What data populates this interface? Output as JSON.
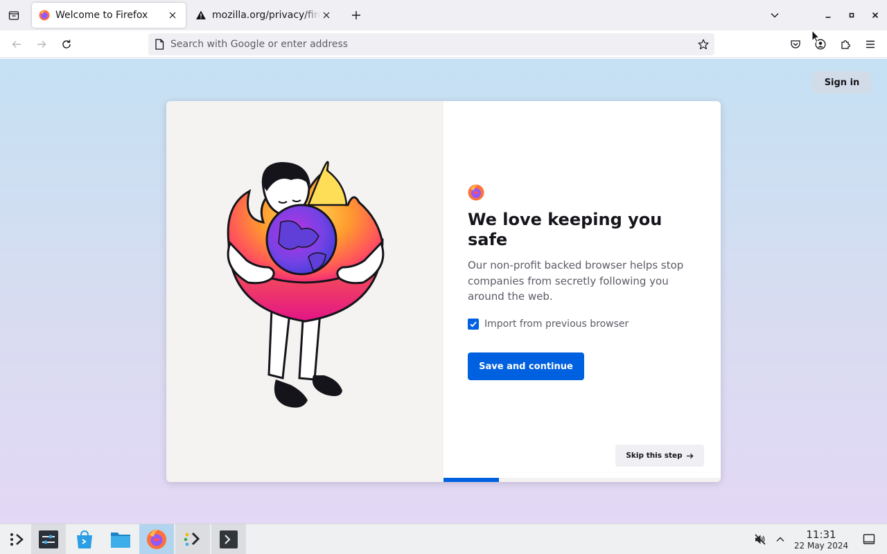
{
  "tabs": [
    {
      "title": "Welcome to Firefox",
      "active": true
    },
    {
      "title": "mozilla.org/privacy/firefox/",
      "active": false
    }
  ],
  "urlbar": {
    "placeholder": "Search with Google or enter address",
    "value": ""
  },
  "toolbar_icons": [
    "pocket-icon",
    "account-icon",
    "extensions-icon",
    "menu-icon"
  ],
  "page": {
    "signin_label": "Sign in",
    "headline": "We love keeping you safe",
    "subtext": "Our non-profit backed browser helps stop companies from secretly following you around the web.",
    "import_label": "Import from previous browser",
    "import_checked": true,
    "primary_label": "Save and continue",
    "skip_label": "Skip this step",
    "progress_fraction": 0.2
  },
  "taskbar": {
    "apps": [
      "app-launcher-icon",
      "system-settings-icon",
      "discover-icon",
      "file-manager-icon",
      "firefox-icon",
      "kdenlive-icon",
      "terminal-icon"
    ],
    "time": "11:31",
    "date": "22 May 2024"
  },
  "colors": {
    "accent": "#0061e0",
    "page_bg_top": "#c5e1f3",
    "page_bg_bottom": "#e3d8f5",
    "firefox_orange": "#ff7139",
    "firefox_purple": "#9059ff"
  }
}
